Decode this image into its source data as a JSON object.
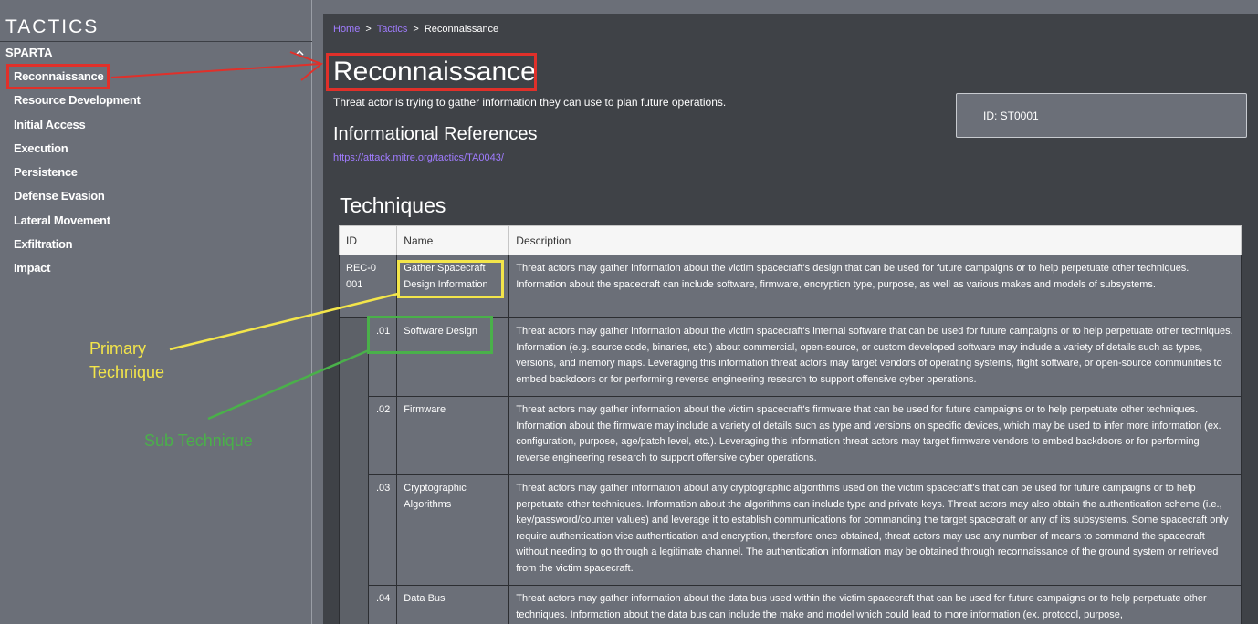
{
  "sidebar": {
    "title": "TACTICS",
    "section": "SPARTA",
    "items": [
      {
        "label": "Reconnaissance"
      },
      {
        "label": "Resource Development"
      },
      {
        "label": "Initial Access"
      },
      {
        "label": "Execution"
      },
      {
        "label": "Persistence"
      },
      {
        "label": "Defense Evasion"
      },
      {
        "label": "Lateral Movement"
      },
      {
        "label": "Exfiltration"
      },
      {
        "label": "Impact"
      }
    ]
  },
  "breadcrumb": {
    "home": "Home",
    "tactics": "Tactics",
    "current": "Reconnaissance",
    "separator": ">"
  },
  "page": {
    "title": "Reconnaissance",
    "description": "Threat actor is trying to gather information they can use to plan future operations.",
    "id_label": "ID: ST0001",
    "refs_heading": "Informational References",
    "ref_link": "https://attack.mitre.org/tactics/TA0043/",
    "techniques_heading": "Techniques"
  },
  "table": {
    "headers": [
      "ID",
      "Name",
      "Description"
    ],
    "primary": {
      "id": "REC-0001",
      "name": "Gather Spacecraft Design Information",
      "description": "Threat actors may gather information about the victim spacecraft's design that can be used for future campaigns or to help perpetuate other techniques. Information about the spacecraft can include software, firmware, encryption type, purpose, as well as various makes and models of subsystems."
    },
    "subs": [
      {
        "id": ".01",
        "name": "Software Design",
        "description": "Threat actors may gather information about the victim spacecraft's internal software that can be used for future campaigns or to help perpetuate other techniques. Information (e.g. source code, binaries, etc.) about commercial, open-source, or custom developed software may include a variety of details such as types, versions, and memory maps. Leveraging this information threat actors may target vendors of operating systems, flight software, or open-source communities to embed backdoors or for performing reverse engineering research to support offensive cyber operations."
      },
      {
        "id": ".02",
        "name": "Firmware",
        "description": "Threat actors may gather information about the victim spacecraft's firmware that can be used for future campaigns or to help perpetuate other techniques. Information about the firmware may include a variety of details such as type and versions on specific devices, which may be used to infer more information (ex. configuration, purpose, age/patch level, etc.). Leveraging this information threat actors may target firmware vendors to embed backdoors or for performing reverse engineering research to support offensive cyber operations."
      },
      {
        "id": ".03",
        "name": "Cryptographic Algorithms",
        "description": "Threat actors may gather information about any cryptographic algorithms used on the victim spacecraft's that can be used for future campaigns or to help perpetuate other techniques. Information about the algorithms can include type and private keys. Threat actors may also obtain the authentication scheme (i.e., key/password/counter values) and leverage it to establish communications for commanding the target spacecraft or any of its subsystems. Some spacecraft only require authentication vice authentication and encryption, therefore once obtained, threat actors may use any number of means to command the spacecraft without needing to go through a legitimate channel. The authentication information may be obtained through reconnaissance of the ground system or retrieved from the victim spacecraft."
      },
      {
        "id": ".04",
        "name": "Data Bus",
        "description": "Threat actors may gather information about the data bus used within the victim spacecraft that can be used for future campaigns or to help perpetuate other techniques. Information about the data bus can include the make and model which could lead to more information (ex. protocol, purpose,"
      }
    ]
  },
  "annotations": {
    "primary_label": "Primary Technique",
    "primary_line1": "Primary",
    "primary_line2": "Technique",
    "sub_label": "Sub Technique",
    "colors": {
      "red": "#e0302a",
      "yellow": "#f3e54a",
      "green": "#4ab04a"
    }
  },
  "colors": {
    "background": "#6b6f78",
    "panel": "#3f4247",
    "link": "#a07cff"
  }
}
